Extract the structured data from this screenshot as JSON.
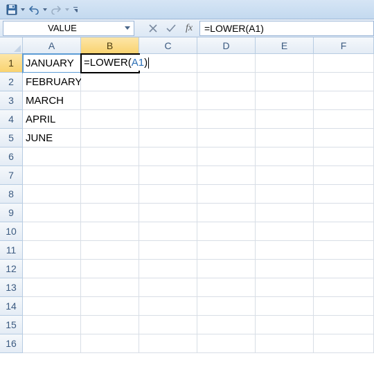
{
  "qat": {
    "save_icon": "save-icon",
    "undo_icon": "undo-icon",
    "redo_icon": "redo-icon"
  },
  "namebox": {
    "value": "VALUE"
  },
  "formula_bar": {
    "cancel": "✕",
    "enter": "✓",
    "fx": "fx",
    "formula": "=LOWER(A1)"
  },
  "columns": [
    "A",
    "B",
    "C",
    "D",
    "E",
    "F"
  ],
  "active_col_index": 1,
  "active_row_index": 0,
  "rows": [
    1,
    2,
    3,
    4,
    5,
    6,
    7,
    8,
    9,
    10,
    11,
    12,
    13,
    14,
    15,
    16
  ],
  "cells": {
    "A1": "JANUARY",
    "A2": "FEBRUARY",
    "A3": "MARCH",
    "A4": "APRIL",
    "A5": "JUNE"
  },
  "editing": {
    "cell": "B1",
    "prefix": "=LOWER(",
    "ref": "A1",
    "suffix": ")"
  },
  "ref_highlight_cell": "A1"
}
